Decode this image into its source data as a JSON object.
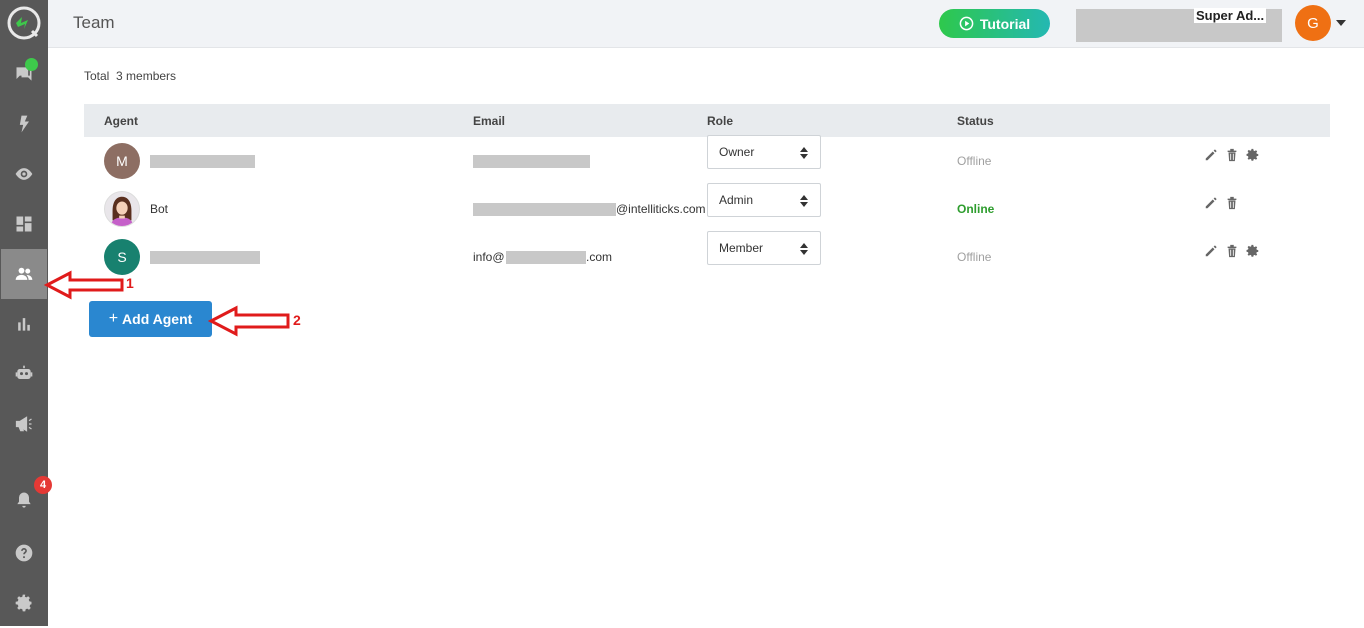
{
  "header": {
    "title": "Team",
    "tutorial_label": "Tutorial",
    "user_role": "Super Ad...",
    "avatar_initial": "G"
  },
  "sidebar": {
    "notification_count": "4",
    "items": [
      "logo-icon",
      "chat-icon",
      "bolt-icon",
      "eye-icon",
      "dashboard-icon",
      "team-icon",
      "analytics-icon",
      "bot-icon",
      "megaphone-icon",
      "bell-icon",
      "help-icon",
      "gear-icon"
    ],
    "active_item": "team-icon"
  },
  "main": {
    "total_label": "Total  3 members",
    "columns": {
      "agent": "Agent",
      "email": "Email",
      "role": "Role",
      "status": "Status"
    },
    "rows": [
      {
        "initial": "M",
        "avatar_color": "#8d6e63",
        "name": "",
        "email_suffix": "",
        "role": "Owner",
        "status": "Offline"
      },
      {
        "initial": "",
        "avatar_color": "#e6e6e6",
        "name": "Bot",
        "email_suffix": "@intelliticks.com",
        "role": "Admin",
        "status": "Online"
      },
      {
        "initial": "S",
        "avatar_color": "#18816f",
        "name": "",
        "email_prefix": "info@",
        "email_suffix": ".com",
        "role": "Member",
        "status": "Offline"
      }
    ],
    "add_agent_label": "Add Agent"
  },
  "annotations": {
    "arrow1_label": "1",
    "arrow2_label": "2"
  },
  "colors": {
    "accent": "#2a87d0",
    "online": "#2e9d2e",
    "badge": "#e53935",
    "arrow": "#e01b1b"
  }
}
